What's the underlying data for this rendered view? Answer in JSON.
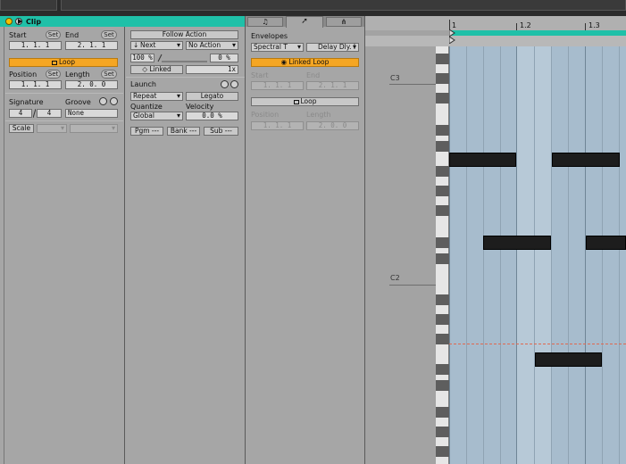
{
  "clip": {
    "title": "Clip",
    "start": {
      "label": "Start",
      "set": "Set",
      "value": "1.   1.   1"
    },
    "end": {
      "label": "End",
      "set": "Set",
      "value": "2.   1.   1"
    },
    "loop": "Loop",
    "position": {
      "label": "Position",
      "set": "Set",
      "value": "1.   1.   1"
    },
    "length": {
      "label": "Length",
      "set": "Set",
      "value": "2.   0.   0"
    },
    "signature": {
      "label": "Signature",
      "num": "4",
      "den": "4"
    },
    "groove": {
      "label": "Groove",
      "value": "None"
    },
    "scale": "Scale"
  },
  "launch_panel": {
    "follow_action": "Follow Action",
    "action_a": "Next",
    "action_b": "No Action",
    "chance_a": "100 %",
    "chance_b": "0 %",
    "linked": "Linked",
    "multiplier": "1x",
    "launch": "Launch",
    "mode": "Repeat",
    "legato": "Legato",
    "quantize_label": "Quantize",
    "quantize": "Global",
    "velocity_label": "Velocity",
    "velocity": "0.0 %",
    "pgm": "Pgm ---",
    "bank": "Bank ---",
    "sub": "Sub ---"
  },
  "envelopes": {
    "label": "Envelopes",
    "device": "Spectral T",
    "control": "Delay Dly. I",
    "linked_loop": "Linked Loop",
    "start_label": "Start",
    "end_label": "End",
    "start": "1.   1.   1",
    "end": "2.   1.   1",
    "loop": "Loop",
    "position_label": "Position",
    "length_label": "Length",
    "position": "1.   1.   1",
    "length": "2.   0.   0"
  },
  "ruler": {
    "marks": [
      "1",
      "1.2",
      "1.3"
    ]
  },
  "piano": {
    "c3": "C3",
    "c2": "C2"
  },
  "colors": {
    "accent": "#1fc0a8",
    "loop_orange": "#f5a623",
    "grid_bg": "#a7bccd",
    "panel": "#a6a6a6"
  },
  "icons": [
    "power-icon",
    "play-icon",
    "note-icon",
    "envelope-icon",
    "branch-icon",
    "loop-icon",
    "link-icon"
  ]
}
